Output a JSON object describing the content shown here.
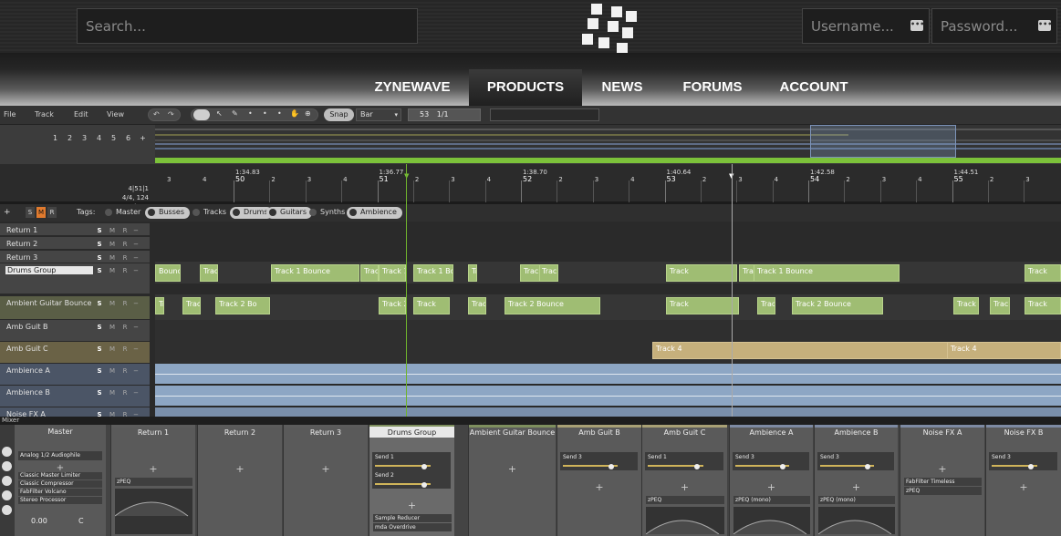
{
  "site": {
    "search_placeholder": "Search...",
    "username_placeholder": "Username...",
    "password_placeholder": "Password...",
    "field_button": "•••",
    "nav": [
      {
        "label": "ZYNEWAVE",
        "active": false
      },
      {
        "label": "PRODUCTS",
        "active": true
      },
      {
        "label": "NEWS",
        "active": false
      },
      {
        "label": "FORUMS",
        "active": false
      },
      {
        "label": "ACCOUNT",
        "active": false
      }
    ]
  },
  "toolbar": {
    "menus": [
      "File",
      "Track",
      "Edit",
      "View"
    ],
    "snap_label": "Snap",
    "grid_value": "Bar",
    "position": "53",
    "position_sub": "1/1"
  },
  "overview": {
    "screens": [
      "1",
      "2",
      "3",
      "4",
      "5",
      "6",
      "+"
    ]
  },
  "ruler": {
    "bars": [
      {
        "bar": "50",
        "time": "1:34.83"
      },
      {
        "bar": "51",
        "time": "1:36.77"
      },
      {
        "bar": "52",
        "time": "1:38.70"
      },
      {
        "bar": "53",
        "time": "1:40.64"
      },
      {
        "bar": "54",
        "time": "1:42.58"
      },
      {
        "bar": "55",
        "time": "1:44.51"
      }
    ],
    "beats": [
      "2",
      "3",
      "4"
    ],
    "meter_line1": "4|51|1",
    "meter_line2": "4/4, 124 bpm"
  },
  "tags": {
    "label": "Tags:",
    "items": [
      {
        "label": "Master",
        "on": false
      },
      {
        "label": "Busses",
        "on": true
      },
      {
        "label": "Tracks",
        "on": false
      },
      {
        "label": "Drums",
        "on": true
      },
      {
        "label": "Guitars",
        "on": true
      },
      {
        "label": "Synths",
        "on": false
      },
      {
        "label": "Ambience",
        "on": true
      }
    ],
    "smr": [
      "S",
      "M",
      "R"
    ]
  },
  "tracks": [
    {
      "name": "Return 1"
    },
    {
      "name": "Return 2"
    },
    {
      "name": "Return 3"
    },
    {
      "name": "Drums Group"
    },
    {
      "name": "Ambient Guitar Bounce"
    },
    {
      "name": "Amb Guit B"
    },
    {
      "name": "Amb Guit C"
    },
    {
      "name": "Ambience A"
    },
    {
      "name": "Ambience B"
    },
    {
      "name": "Noise FX A"
    }
  ],
  "track_buttons": [
    "S",
    "M",
    "R"
  ],
  "clips": {
    "drums": [
      "Bounce",
      "Track",
      "Track 1 Bounce",
      "Track",
      "Track 1 Bo",
      "Track 1 Bo",
      "Track 1 Bo",
      "Track 1 Bounce",
      "Track 1 Bounce",
      "Track",
      "Track 1 Bounce",
      "Track 1 Bounce",
      "Track"
    ],
    "guitar": [
      "Track",
      "Track 2 Bounce",
      "Track 2 Bo",
      "Track 2 Bo",
      "Track",
      "Track 2 Bounce",
      "Track 2 Bounce",
      "Track",
      "Track",
      "Track 2 Bounce",
      "Track 2",
      "Track",
      "Track"
    ],
    "ambc": [
      "Track 4",
      "Track 4"
    ]
  },
  "mixer": {
    "label": "Mixer",
    "master": {
      "name": "Master",
      "preset": "Analog 1/2 Audiophile",
      "plugins": [
        "Classic Master Limiter",
        "Classic Compressor",
        "FabFilter Volcano",
        "Stereo Processor"
      ],
      "volume": "0.00",
      "pan": "C"
    },
    "channels": [
      {
        "name": "Return 1",
        "sends": [],
        "plugins": [
          "zPEQ"
        ]
      },
      {
        "name": "Return 2",
        "sends": [],
        "plugins": []
      },
      {
        "name": "Return 3",
        "sends": [],
        "plugins": []
      },
      {
        "name": "Drums Group",
        "sends": [
          "Send 1",
          "Send 2"
        ],
        "plugins": [
          "Sample Reducer",
          "mda Overdrive"
        ]
      },
      {
        "name": "Ambient Guitar Bounce",
        "sends": [],
        "plugins": []
      },
      {
        "name": "Amb Guit B",
        "sends": [
          "Send 3"
        ],
        "plugins": []
      },
      {
        "name": "Amb Guit C",
        "sends": [
          "Send 1"
        ],
        "plugins": [
          "zPEQ"
        ]
      },
      {
        "name": "Ambience A",
        "sends": [
          "Send 3"
        ],
        "plugins": [
          "zPEQ (mono)"
        ]
      },
      {
        "name": "Ambience B",
        "sends": [
          "Send 3"
        ],
        "plugins": [
          "zPEQ (mono)"
        ]
      },
      {
        "name": "Noise FX A",
        "sends": [],
        "plugins": [
          "FabFilter Timeless",
          "zPEQ"
        ]
      },
      {
        "name": "Noise FX B",
        "sends": [
          "Send 3"
        ],
        "plugins": []
      }
    ]
  },
  "colors": {
    "accent_green": "#7cc23a",
    "clip_green": "#9fbd73",
    "clip_tan": "#c6b07c",
    "audio_blue": "#8da6c4"
  }
}
